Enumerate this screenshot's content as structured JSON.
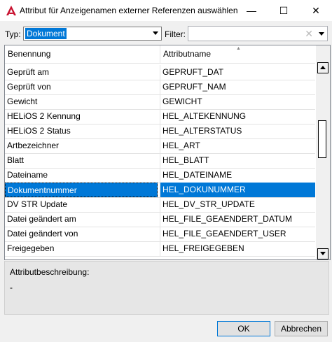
{
  "window": {
    "title": "Attribut für Anzeigenamen externer Referenzen auswählen",
    "minimize_glyph": "—",
    "maximize_glyph": "☐",
    "close_glyph": "✕"
  },
  "toolbar": {
    "typ_label": "Typ:",
    "typ_value": "Dokument",
    "filter_label": "Filter:",
    "filter_value": "",
    "filter_clear_glyph": "✕"
  },
  "grid": {
    "columns": [
      "Benennung",
      "Attributname"
    ],
    "rows": [
      {
        "name": "Geprüft am",
        "attr": "GEPRUFT_DAT"
      },
      {
        "name": "Geprüft von",
        "attr": "GEPRUFT_NAM"
      },
      {
        "name": "Gewicht",
        "attr": "GEWICHT"
      },
      {
        "name": "HELiOS 2  Kennung",
        "attr": "HEL_ALTEKENNUNG"
      },
      {
        "name": "HELiOS 2 Status",
        "attr": "HEL_ALTERSTATUS"
      },
      {
        "name": "Artbezeichner",
        "attr": "HEL_ART"
      },
      {
        "name": "Blatt",
        "attr": "HEL_BLATT"
      },
      {
        "name": "Dateiname",
        "attr": "HEL_DATEINAME"
      },
      {
        "name": "Dokumentnummer",
        "attr": "HEL_DOKUNUMMER",
        "selected": true
      },
      {
        "name": "DV STR Update",
        "attr": "HEL_DV_STR_UPDATE"
      },
      {
        "name": "Datei geändert am",
        "attr": "HEL_FILE_GEAENDERT_DATUM"
      },
      {
        "name": "Datei geändert von",
        "attr": "HEL_FILE_GEAENDERT_USER"
      },
      {
        "name": "Freigegeben",
        "attr": "HEL_FREIGEGEBEN"
      }
    ]
  },
  "description": {
    "label": "Attributbeschreibung:",
    "value": "-"
  },
  "buttons": {
    "ok": "OK",
    "cancel": "Abbrechen"
  },
  "colors": {
    "selection": "#0078d7",
    "app_icon": "#c8102e"
  },
  "icons": {
    "app": "autocad-a-icon",
    "sort": "sort-ascending-icon"
  }
}
